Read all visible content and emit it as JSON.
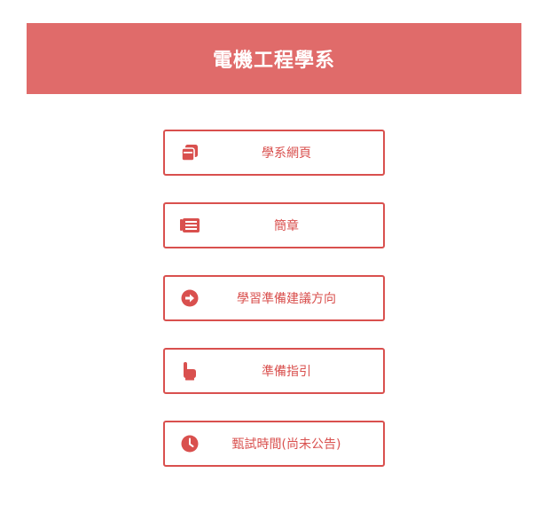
{
  "header": {
    "title": "電機工程學系"
  },
  "menu": {
    "items": [
      {
        "label": "學系網頁",
        "icon": "window-restore-icon"
      },
      {
        "label": "簡章",
        "icon": "newspaper-icon"
      },
      {
        "label": "學習準備建議方向",
        "icon": "arrow-circle-right-icon"
      },
      {
        "label": "準備指引",
        "icon": "hand-pointer-icon"
      },
      {
        "label": "甄試時間(尚未公告)",
        "icon": "clock-icon"
      }
    ]
  },
  "colors": {
    "header_bg": "#e06b6a",
    "accent": "#d9504e"
  }
}
